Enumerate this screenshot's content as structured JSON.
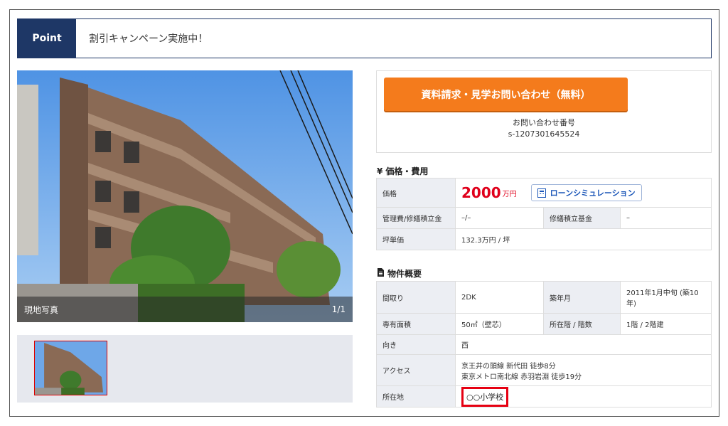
{
  "point": {
    "tag": "Point",
    "text": "割引キャンペーン実施中！"
  },
  "photo": {
    "caption_left": "現地写真",
    "caption_right": "1/1"
  },
  "inquiry": {
    "button_label": "資料請求・見学お問い合わせ（無料）",
    "number_label": "お問い合わせ番号",
    "number_value": "s-1207301645524"
  },
  "price_section": {
    "title": "価格・費用",
    "price_label": "価格",
    "price_value": "2000",
    "price_unit": "万円",
    "loan_button": "ローンシミュレーション",
    "mgmt_label": "管理費/修繕積立金",
    "mgmt_value": "–/–",
    "repair_fund_label": "修繕積立基金",
    "repair_fund_value": "–",
    "tsubo_label": "坪単価",
    "tsubo_value": "132.3万円 / 坪"
  },
  "overview_section": {
    "title": "物件概要",
    "layout_label": "間取り",
    "layout_value": "2DK",
    "age_label": "築年月",
    "age_value": "2011年1月中旬 (築10年)",
    "area_label": "専有面積",
    "area_value": "50㎡（壁芯）",
    "floor_label": "所在階 / 階数",
    "floor_value": "1階 / 2階建",
    "direction_label": "向き",
    "direction_value": "西",
    "access_label": "アクセス",
    "access_line1": "京王井の頭線 新代田 徒歩8分",
    "access_line2": "東京メトロ南北線 赤羽岩淵 徒歩19分",
    "location_label": "所在地",
    "location_value": "○○小学校"
  },
  "colors": {
    "navy": "#1e3766",
    "orange": "#f47b1c",
    "price_red": "#e0001b",
    "highlight_red": "#e60012"
  }
}
